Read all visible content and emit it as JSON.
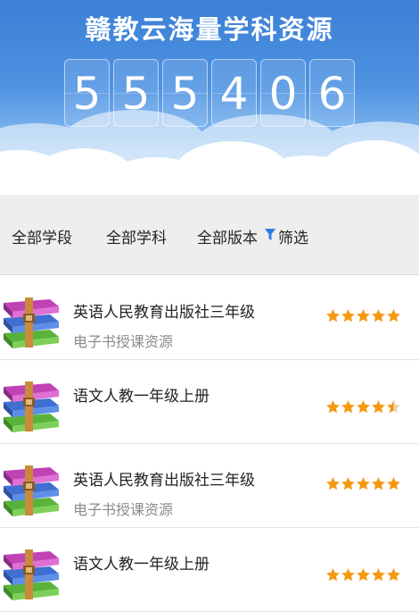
{
  "banner": {
    "title": "赣教云海量学科资源",
    "counter_digits": [
      "5",
      "5",
      "5",
      "4",
      "0",
      "6"
    ]
  },
  "filters": {
    "stage": "全部学段",
    "subject": "全部学科",
    "edition": "全部版本",
    "filter": "筛选"
  },
  "colors": {
    "banner_blue": "#3b7fd6",
    "star_orange": "#f39a12",
    "filter_icon_blue": "#2a7de1"
  },
  "icons": {
    "resource": "archive-books-icon",
    "rating": "star-icon",
    "filter": "funnel-icon"
  },
  "resources": [
    {
      "title": "英语人民教育出版社三年级",
      "subtitle": "电子书授课资源",
      "rating": 5
    },
    {
      "title": "语文人教一年级上册",
      "subtitle": "",
      "rating": 4.5
    },
    {
      "title": "英语人民教育出版社三年级",
      "subtitle": "电子书授课资源",
      "rating": 5
    },
    {
      "title": "语文人教一年级上册",
      "subtitle": "",
      "rating": 5
    }
  ]
}
